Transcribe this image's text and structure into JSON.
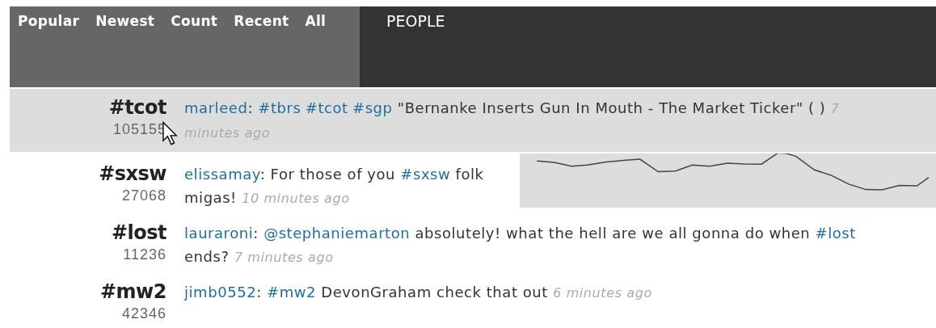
{
  "nav": {
    "tabs": [
      {
        "label": "Popular"
      },
      {
        "label": "Newest"
      },
      {
        "label": "Count"
      },
      {
        "label": "Recent"
      },
      {
        "label": "All"
      }
    ],
    "section_title": "PEOPLE"
  },
  "topics": [
    {
      "tag": "#tcot",
      "count": "105155",
      "highlighted": true,
      "lines": [
        [
          {
            "kind": "user",
            "text": "marleed"
          },
          {
            "kind": "text",
            "text": ": "
          },
          {
            "kind": "hashtag",
            "text": "#tbrs"
          },
          {
            "kind": "hashtag",
            "text": "#tcot"
          },
          {
            "kind": "hashtag",
            "text": "#sgp"
          },
          {
            "kind": "text",
            "text": " \"Bernanke Inserts Gun In Mouth - The Market Ticker\" ( ) "
          },
          {
            "kind": "time",
            "text": "7"
          }
        ],
        [
          {
            "kind": "time",
            "text": "minutes ago"
          }
        ]
      ]
    },
    {
      "tag": "#sxsw",
      "count": "27068",
      "highlighted": false,
      "lines": [
        [
          {
            "kind": "user",
            "text": "elissamay"
          },
          {
            "kind": "text",
            "text": ": For those of you "
          },
          {
            "kind": "hashtag",
            "text": "#sxsw"
          },
          {
            "kind": "text",
            "text": " folk"
          }
        ],
        [
          {
            "kind": "text",
            "text": "migas! "
          },
          {
            "kind": "time",
            "text": "10 minutes ago"
          }
        ]
      ]
    },
    {
      "tag": "#lost",
      "count": "11236",
      "highlighted": false,
      "lines": [
        [
          {
            "kind": "user",
            "text": "lauraroni"
          },
          {
            "kind": "text",
            "text": ": "
          },
          {
            "kind": "user",
            "text": "@stephaniemarton"
          },
          {
            "kind": "text",
            "text": " absolutely! what the hell are we all gonna do when "
          },
          {
            "kind": "hashtag",
            "text": "#lost"
          }
        ],
        [
          {
            "kind": "text",
            "text": "ends? "
          },
          {
            "kind": "time",
            "text": "7 minutes ago"
          }
        ]
      ]
    },
    {
      "tag": "#mw2",
      "count": "42346",
      "highlighted": false,
      "lines": [
        [
          {
            "kind": "user",
            "text": "jimb0552"
          },
          {
            "kind": "text",
            "text": ": "
          },
          {
            "kind": "hashtag",
            "text": "#mw2"
          },
          {
            "kind": "text",
            "text": " DevonGraham check that out "
          },
          {
            "kind": "time",
            "text": "6 minutes ago"
          }
        ]
      ]
    }
  ]
}
